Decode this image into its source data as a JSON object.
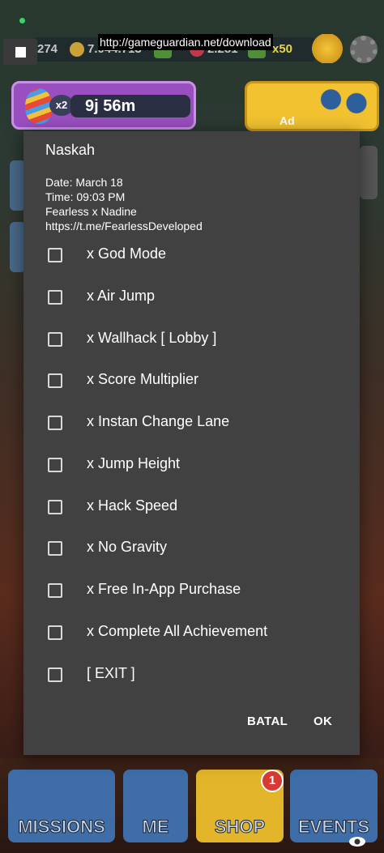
{
  "overlay": {
    "url": "http://gameguardian.net/download"
  },
  "hud": {
    "keys_count": "274",
    "coins_count": "7.044.713",
    "currency2_count": "2.281",
    "multiplier": "x50",
    "timer": "9j 56m",
    "timer_multiplier": "x2",
    "ad_label": "Ad",
    "shop_badge_count": "1"
  },
  "bottom_menu": [
    {
      "label": "MISSIONS"
    },
    {
      "label": "ME"
    },
    {
      "label": "SHOP"
    },
    {
      "label": "EVENTS"
    }
  ],
  "dialog": {
    "title": "Naskah",
    "info": {
      "date": "Date: March 18",
      "time": "Time: 09:03 PM",
      "credit": "Fearless x Nadine",
      "link": "https://t.me/FearlessDeveloped"
    },
    "options": [
      {
        "label": "x God Mode",
        "checked": false
      },
      {
        "label": "x Air Jump",
        "checked": false
      },
      {
        "label": "x Wallhack [ Lobby ]",
        "checked": false
      },
      {
        "label": "x Score Multiplier",
        "checked": false
      },
      {
        "label": "x Instan Change Lane",
        "checked": false
      },
      {
        "label": "x Jump Height",
        "checked": false
      },
      {
        "label": "x Hack Speed",
        "checked": false
      },
      {
        "label": "x No Gravity",
        "checked": false
      },
      {
        "label": "x Free In-App Purchase",
        "checked": false
      },
      {
        "label": "x Complete All Achievement",
        "checked": false
      },
      {
        "label": "[ EXIT ]",
        "checked": false
      }
    ],
    "cancel_label": "BATAL",
    "ok_label": "OK"
  },
  "colors": {
    "dialog_bg": "#414141",
    "text": "#ffffff",
    "checkbox_border": "#d8d8d8"
  }
}
